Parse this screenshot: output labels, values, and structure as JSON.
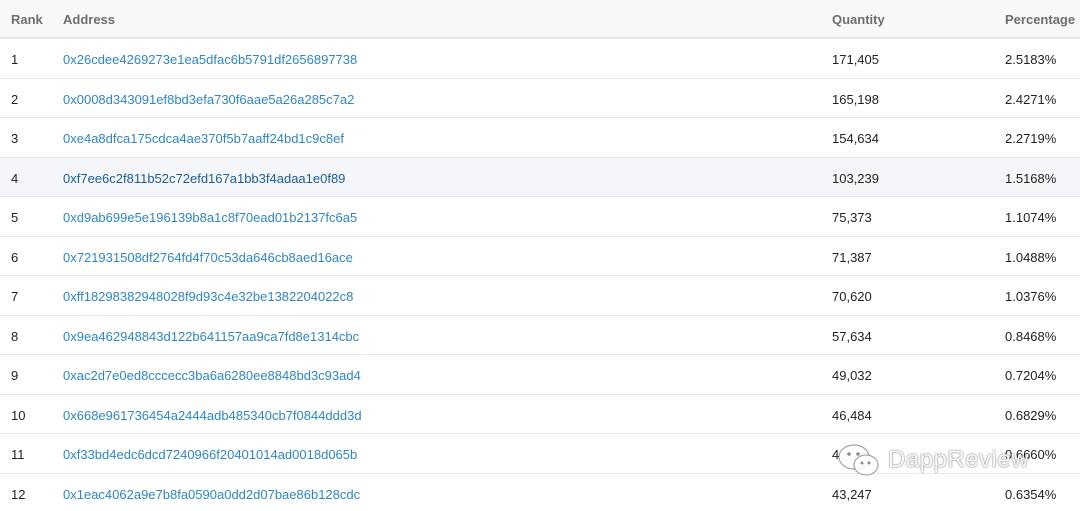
{
  "header": {
    "rank": "Rank",
    "address": "Address",
    "quantity": "Quantity",
    "percentage": "Percentage"
  },
  "rows": [
    {
      "rank": "1",
      "address": "0x26cdee4269273e1ea5dfac6b5791df2656897738",
      "quantity": "171,405",
      "percentage": "2.5183%"
    },
    {
      "rank": "2",
      "address": "0x0008d343091ef8bd3efa730f6aae5a26a285c7a2",
      "quantity": "165,198",
      "percentage": "2.4271%"
    },
    {
      "rank": "3",
      "address": "0xe4a8dfca175cdca4ae370f5b7aaff24bd1c9c8ef",
      "quantity": "154,634",
      "percentage": "2.2719%"
    },
    {
      "rank": "4",
      "address": "0xf7ee6c2f811b52c72efd167a1bb3f4adaa1e0f89",
      "quantity": "103,239",
      "percentage": "1.5168%"
    },
    {
      "rank": "5",
      "address": "0xd9ab699e5e196139b8a1c8f70ead01b2137fc6a5",
      "quantity": "75,373",
      "percentage": "1.1074%"
    },
    {
      "rank": "6",
      "address": "0x721931508df2764fd4f70c53da646cb8aed16ace",
      "quantity": "71,387",
      "percentage": "1.0488%"
    },
    {
      "rank": "7",
      "address": "0xff18298382948028f9d93c4e32be1382204022c8",
      "quantity": "70,620",
      "percentage": "1.0376%"
    },
    {
      "rank": "8",
      "address": "0x9ea462948843d122b641157aa9ca7fd8e1314cbc",
      "quantity": "57,634",
      "percentage": "0.8468%"
    },
    {
      "rank": "9",
      "address": "0xac2d7e0ed8cccecc3ba6a6280ee8848bd3c93ad4",
      "quantity": "49,032",
      "percentage": "0.7204%"
    },
    {
      "rank": "10",
      "address": "0x668e961736454a2444adb485340cb7f0844ddd3d",
      "quantity": "46,484",
      "percentage": "0.6829%"
    },
    {
      "rank": "11",
      "address": "0xf33bd4edc6dcd7240966f20401014ad0018d065b",
      "quantity": "4",
      "percentage": "0.6660%"
    },
    {
      "rank": "12",
      "address": "0x1eac4062a9e7b8fa0590a0dd2d07bae86b128cdc",
      "quantity": "43,247",
      "percentage": "0.6354%"
    }
  ],
  "highlighted_row_index": 3,
  "colors": {
    "link": "#2f86c6",
    "link_hover": "#1a5e96",
    "header_bg": "#f7f8fa",
    "row_hover_bg": "#f5f6f9"
  },
  "watermark": {
    "text": "DappReview",
    "icon": "wechat-icon"
  }
}
